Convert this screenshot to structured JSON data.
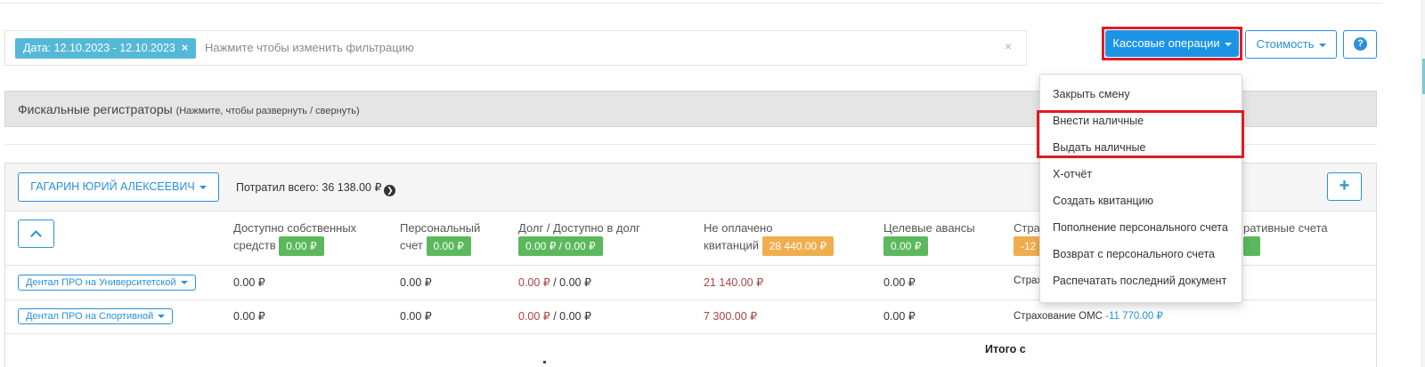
{
  "filter": {
    "tag_label": "Дата: 12.10.2023 - 12.10.2023",
    "tag_remove": "×",
    "placeholder": "Нажмите чтобы изменить фильтрацию",
    "clear": "×"
  },
  "toolbar": {
    "cash_operations_label": "Кассовые операции",
    "cost_label": "Стоимость",
    "help_glyph": "?"
  },
  "fiscal": {
    "title": "Фискальные регистраторы",
    "hint": "(Нажмите, чтобы развернуть / свернуть)"
  },
  "patient": {
    "name": "ГАГАРИН ЮРИЙ АЛЕКСЕЕВИЧ",
    "spent_label": "Потратил всего: 36 138.00 ₽",
    "add_glyph": "+"
  },
  "columns": {
    "own_funds_line1": "Доступно собственных",
    "own_funds_line2": "средств",
    "own_funds_badge": "0.00 ₽",
    "personal_line1": "Персональный",
    "personal_line2": "счет",
    "personal_badge": "0.00 ₽",
    "debt_line1": "Долг / Доступно в долг",
    "debt_badge": "0.00 ₽ / 0.00 ₽",
    "unpaid_line1": "Не оплачено",
    "unpaid_line2": "квитанций",
    "unpaid_badge": "28 440.00 ₽",
    "target_line1": "Целевые авансы",
    "target_badge": "0.00 ₽",
    "insurance_line1": "Стра",
    "insurance_badge": "-12",
    "corporate_line1": "ративные счета"
  },
  "rows": [
    {
      "clinic": "Дентал ПРО на Университетской",
      "own": "0.00 ₽",
      "personal": "0.00 ₽",
      "debt": "0.00 ₽",
      "debt_avail": " / 0.00 ₽",
      "unpaid": "21 140.00 ₽",
      "target": "0.00 ₽",
      "insurance": "Страх"
    },
    {
      "clinic": "Дентал ПРО на Спортивной",
      "own": "0.00 ₽",
      "personal": "0.00 ₽",
      "debt": "0.00 ₽",
      "debt_avail": " / 0.00 ₽",
      "unpaid": "7 300.00 ₽",
      "target": "0.00 ₽",
      "insurance_label": "Страхование ОМС ",
      "insurance_value": "-11 770.00 ₽"
    }
  ],
  "footer": {
    "total_label": "Итого с"
  },
  "menu": {
    "items": [
      "Закрыть смену",
      "Внести наличные",
      "Выдать наличные",
      "X-отчёт",
      "Создать квитанцию",
      "Пополнение персонального счета",
      "Возврат с персонального счета",
      "Распечатать последний документ"
    ]
  },
  "colors": {
    "primary": "#1b94e6",
    "outline_blue": "#2b90d9",
    "highlight_red": "#e01b22",
    "badge_green": "#5cb85c",
    "badge_orange": "#f0ad4e",
    "debt_red": "#a94442",
    "filter_tag": "#56b8d7"
  }
}
